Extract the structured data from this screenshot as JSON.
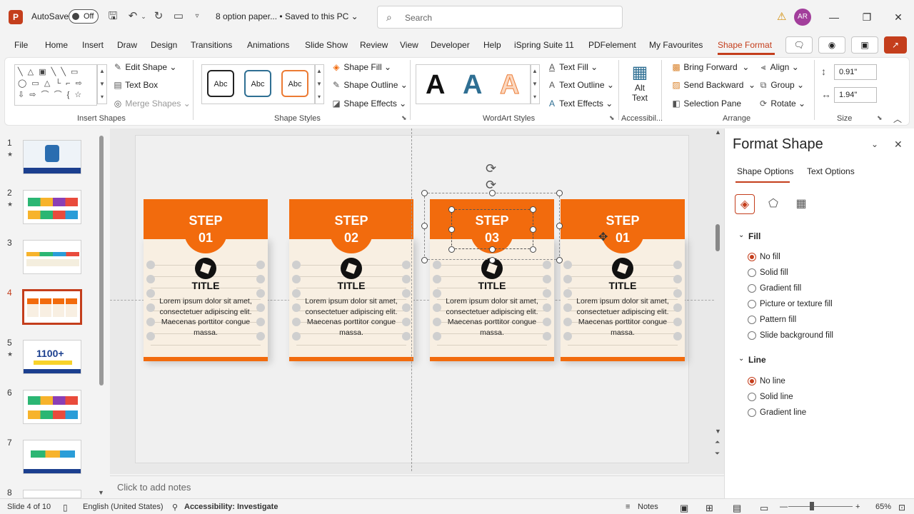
{
  "titlebar": {
    "app_logo": "P",
    "autosave_label": "AutoSave",
    "autosave_state": "Off",
    "doc_title": "8 option paper...  •  Saved to this PC ⌄",
    "search_placeholder": "Search",
    "avatar_initials": "AR"
  },
  "menu": {
    "items": [
      "File",
      "Home",
      "Insert",
      "Draw",
      "Design",
      "Transitions",
      "Animations",
      "Slide Show",
      "Review",
      "View",
      "Developer",
      "Help",
      "iSpring Suite 11",
      "PDFelement",
      "My Favourites",
      "Shape Format"
    ],
    "active": "Shape Format"
  },
  "ribbon": {
    "insert_shapes": {
      "label": "Insert Shapes",
      "edit_shape": "Edit Shape",
      "text_box": "Text Box",
      "merge_shapes": "Merge Shapes"
    },
    "shape_styles": {
      "label": "Shape Styles",
      "preset_text": "Abc",
      "shape_fill": "Shape Fill",
      "shape_outline": "Shape Outline",
      "shape_effects": "Shape Effects"
    },
    "wordart": {
      "label": "WordArt Styles",
      "letter": "A",
      "text_fill": "Text Fill",
      "text_outline": "Text Outline",
      "text_effects": "Text Effects"
    },
    "accessibility": {
      "label": "Accessibil...",
      "alt_text_line1": "Alt",
      "alt_text_line2": "Text"
    },
    "arrange": {
      "label": "Arrange",
      "bring_forward": "Bring Forward",
      "send_backward": "Send Backward",
      "selection_pane": "Selection Pane",
      "align": "Align",
      "group": "Group",
      "rotate": "Rotate"
    },
    "size": {
      "label": "Size",
      "height": "0.91\"",
      "width": "1.94\""
    }
  },
  "thumbnails": [
    {
      "num": "1",
      "star": true
    },
    {
      "num": "2",
      "star": true
    },
    {
      "num": "3",
      "star": false
    },
    {
      "num": "4",
      "star": false,
      "selected": true
    },
    {
      "num": "5",
      "star": true,
      "badge": "1100+"
    },
    {
      "num": "6",
      "star": false
    },
    {
      "num": "7",
      "star": false
    },
    {
      "num": "8",
      "star": false
    }
  ],
  "slide": {
    "cards": [
      {
        "step": "STEP",
        "num": "01",
        "title": "TITLE",
        "text": "Lorem ipsum dolor sit amet, consectetuer adipiscing elit. Maecenas porttitor congue massa."
      },
      {
        "step": "STEP",
        "num": "02",
        "title": "TITLE",
        "text": "Lorem ipsum dolor sit amet, consectetuer adipiscing elit. Maecenas porttitor congue massa."
      },
      {
        "step": "STEP",
        "num": "03",
        "title": "TITLE",
        "text": "Lorem ipsum dolor sit amet, consectetuer adipiscing elit. Maecenas porttitor congue massa."
      },
      {
        "step": "STEP",
        "num": "01",
        "title": "TITLE",
        "text": "Lorem ipsum dolor sit amet, consectetuer adipiscing elit. Maecenas porttitor congue massa."
      }
    ],
    "accent_color": "#f26b0d"
  },
  "notes_placeholder": "Click to add notes",
  "format_pane": {
    "title": "Format Shape",
    "tabs": [
      "Shape Options",
      "Text Options"
    ],
    "fill_section": "Fill",
    "fill_options": [
      "No fill",
      "Solid fill",
      "Gradient fill",
      "Picture or texture fill",
      "Pattern fill",
      "Slide background fill"
    ],
    "fill_selected": "No fill",
    "line_section": "Line",
    "line_options": [
      "No line",
      "Solid line",
      "Gradient line"
    ],
    "line_selected": "No line"
  },
  "status": {
    "slide_info": "Slide 4 of 10",
    "language": "English (United States)",
    "accessibility": "Accessibility: Investigate",
    "notes": "Notes",
    "zoom": "65%"
  },
  "colors": {
    "brand": "#c43e1c",
    "orange": "#f26b0d"
  }
}
